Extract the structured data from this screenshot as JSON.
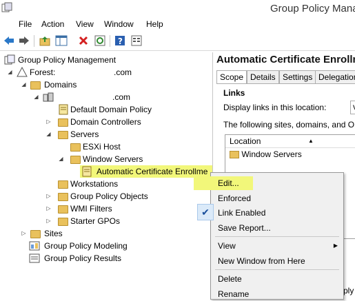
{
  "window": {
    "title": "Group Policy Mana"
  },
  "menubar": {
    "items": [
      "File",
      "Action",
      "View",
      "Window",
      "Help"
    ]
  },
  "toolbar": {
    "buttons": [
      "back-icon",
      "forward-icon",
      "up-folder-icon",
      "show-hide-tree-icon",
      "delete-icon",
      "refresh-icon",
      "help-icon",
      "properties-icon"
    ]
  },
  "tree": {
    "root": "Group Policy Management",
    "forest": "Forest: ",
    "forest_suffix": ".com",
    "domains": "Domains",
    "domain_suffix": ".com",
    "default_domain_policy": "Default Domain Policy",
    "domain_controllers": "Domain Controllers",
    "servers": "Servers",
    "esxi_host": "ESXi Host",
    "window_servers": "Window Servers",
    "auto_cert": "Automatic Certificate Enrollme",
    "workstations": "Workstations",
    "gpo": "Group Policy Objects",
    "wmi": "WMI Filters",
    "starter": "Starter GPOs",
    "sites": "Sites",
    "modeling": "Group Policy Modeling",
    "results": "Group Policy Results"
  },
  "right": {
    "header": "Automatic Certificate Enrollm",
    "tabs": [
      "Scope",
      "Details",
      "Settings",
      "Delegation"
    ],
    "links_heading": "Links",
    "display_links_label": "Display links in this location:",
    "dropdown_value": "v",
    "following_text": "The following sites, domains, and OUs a",
    "column_location": "Location",
    "row_1": "Window Servers",
    "partial_text": "ply t"
  },
  "context_menu": {
    "edit": "Edit...",
    "enforced": "Enforced",
    "link_enabled": "Link Enabled",
    "link_enabled_checked": true,
    "save_report": "Save Report...",
    "view": "View",
    "new_window": "New Window from Here",
    "delete": "Delete",
    "rename": "Rename"
  },
  "colors": {
    "highlight": "#f2f77a",
    "folder": "#e9c15c",
    "check": "#1a4f9c"
  }
}
